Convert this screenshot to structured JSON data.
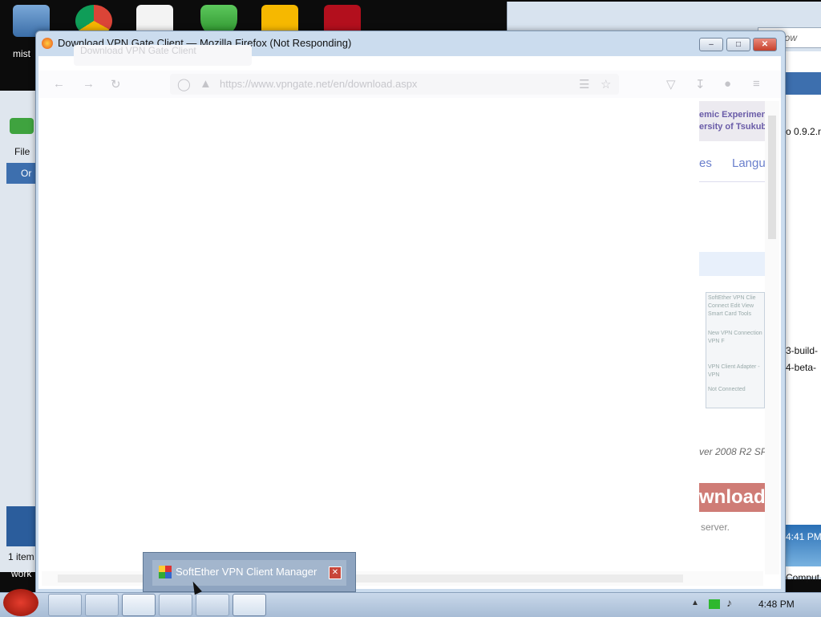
{
  "desktop": {
    "label_fragment": "mist",
    "icons": [
      "computer-icon",
      "chrome-icon",
      "solitaire-icon",
      "security-shield-icon",
      "game-icon",
      "brand-icon"
    ]
  },
  "firefox": {
    "window_title": "Download VPN Gate Client — Mozilla Firefox (Not Responding)",
    "tab_title": "Download VPN Gate Client",
    "url": "https://www.vpngate.net/en/download.aspx",
    "minimize": "–",
    "maximize": "□",
    "close": "✕",
    "page": {
      "banner_line1": "emic Experiment",
      "banner_line2": "ersity of Tsukuba",
      "nav_item_1": "es",
      "nav_item_2": "Langu",
      "thumbnail": {
        "title": "SoftEther VPN Clie",
        "menu": "Connect  Edit  View",
        "menu2": "Smart Card  Tools",
        "item1": "New VPN Connection",
        "item2": "VPN F",
        "item3": "VPN Client Adapter - VPN",
        "status": "Not Connected"
      },
      "os_line": "ver 2008 R2 SP",
      "download_fragment": "wnload",
      "server_text": "server."
    }
  },
  "background_window": {
    "search_placeholder": "rch Dow",
    "menu_file": "File",
    "menu_org": "Or",
    "items_label": "1 item",
    "work_label": "work",
    "right_texts": [
      "o 0.9.2.r",
      "3-build-",
      "4-beta-",
      "4:41 PM",
      "Comput"
    ]
  },
  "taskbar_popup": {
    "label": "SoftEther VPN Client Manager",
    "close": "✕"
  },
  "taskbar": {
    "time": "4:48 PM",
    "buttons": [
      "explorer",
      "chrome",
      "firefox",
      "tool",
      "7zip",
      "softether"
    ]
  }
}
